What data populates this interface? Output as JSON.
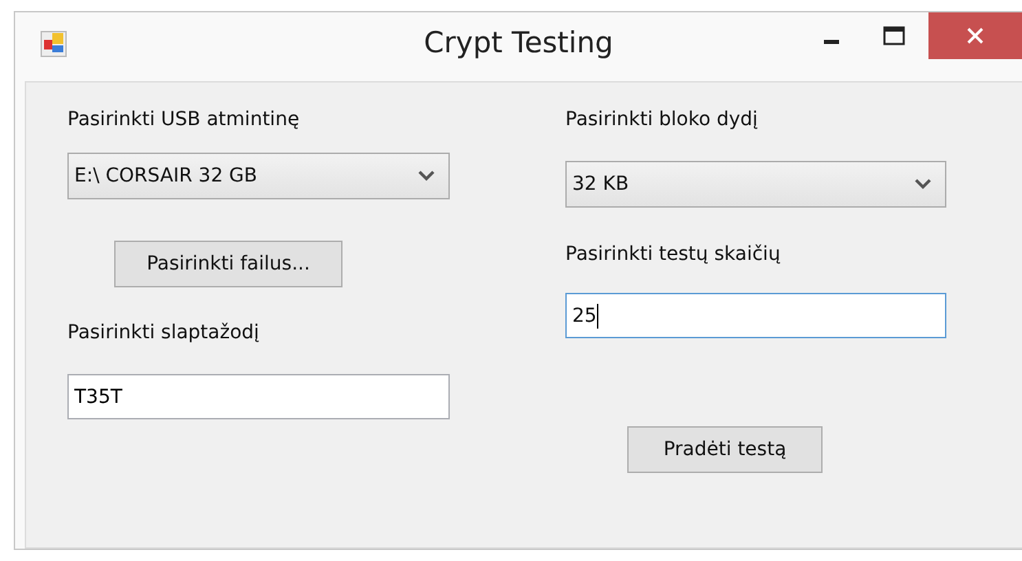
{
  "window": {
    "title": "Crypt Testing",
    "controls": [
      {
        "kind": "minimize"
      },
      {
        "kind": "maximize"
      },
      {
        "kind": "close"
      }
    ]
  },
  "left": {
    "usb_label": "Pasirinkti USB atmintinę",
    "usb_combo": {
      "value": "E:\\ CORSAIR 32 GB"
    },
    "files_button": "Pasirinkti failus...",
    "password_label": "Pasirinkti slaptažodį",
    "password_field": {
      "value": "T35T",
      "focused": false
    }
  },
  "right": {
    "block_label": "Pasirinkti bloko dydį",
    "block_combo": {
      "value": "32 KB"
    },
    "tests_label": "Pasirinkti testų skaičių",
    "tests_field": {
      "value": "25",
      "focused": true
    },
    "start_button": "Pradėti testą"
  }
}
